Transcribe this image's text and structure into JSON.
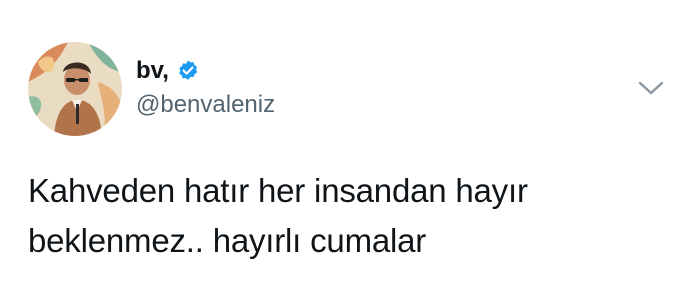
{
  "author": {
    "display_name": "bv,",
    "handle": "@benvaleniz",
    "verified": true,
    "verified_color": "#1d9bf0"
  },
  "tweet": {
    "text_lines": [
      "Kahveden hatır her insandan hayır",
      "beklenmez.. hayırlı cumalar"
    ]
  },
  "icons": {
    "verified": "verified-badge-icon",
    "more": "chevron-down-icon"
  }
}
